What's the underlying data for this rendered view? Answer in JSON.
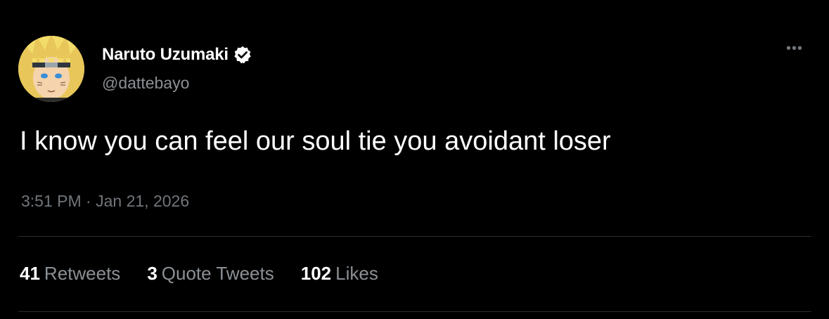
{
  "tweet": {
    "author": {
      "display_name": "Naruto Uzumaki",
      "handle": "@dattebayo",
      "verified": true,
      "avatar_icon": "anime-character-avatar"
    },
    "more_icon": "ellipsis-icon",
    "more_glyph": "•••",
    "text": "I know you can feel our soul tie you avoidant loser",
    "time": "3:51 PM",
    "separator": "·",
    "date": "Jan 21, 2026",
    "stats": {
      "retweets": {
        "count": "41",
        "label": "Retweets"
      },
      "quotes": {
        "count": "3",
        "label": "Quote Tweets"
      },
      "likes": {
        "count": "102",
        "label": "Likes"
      }
    }
  },
  "colors": {
    "background": "#000000",
    "primary_text": "#ffffff",
    "secondary_text": "#71767b",
    "divider": "#2a2d31"
  }
}
